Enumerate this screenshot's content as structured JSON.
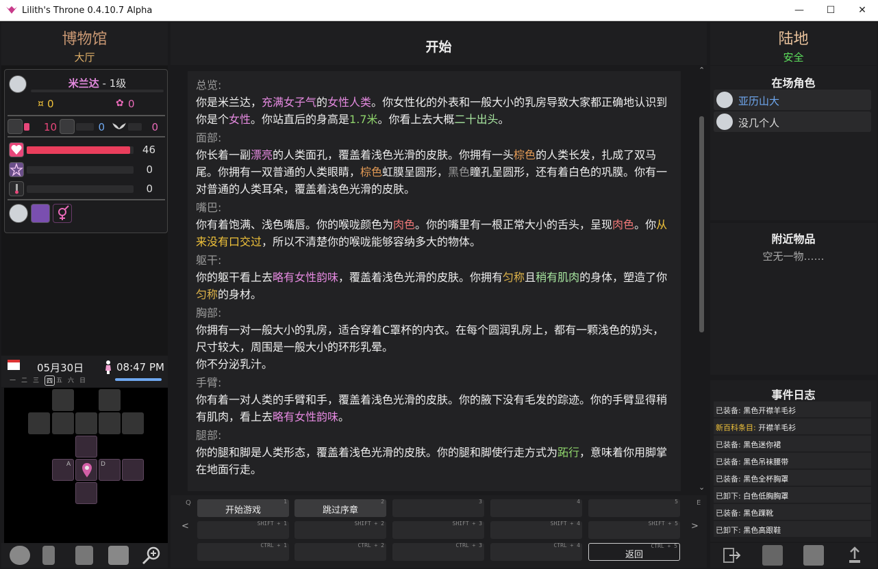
{
  "window": {
    "title": "Lilith's Throne 0.4.10.7 Alpha",
    "min": "—",
    "max": "☐",
    "close": "✕"
  },
  "left": {
    "location_title": "博物馆",
    "location_sub": "大厅",
    "character": {
      "name": "米兰达",
      "level": " - 1级",
      "money": "0",
      "essence": "0",
      "corruption_values": [
        "10",
        "0",
        "0"
      ],
      "health": {
        "value": "46",
        "fraction": 0.97
      },
      "mana": {
        "value": "0"
      },
      "arousal": {
        "value": "0"
      }
    },
    "date": "05月30日",
    "weekdays": [
      "一",
      "二",
      "三",
      "四",
      "五",
      "六",
      "日"
    ],
    "time": "08:47 PM",
    "map_labels": [
      "A",
      "D"
    ]
  },
  "center": {
    "title": "开始",
    "sections": [
      {
        "title": "总览:"
      },
      {
        "title": "面部:"
      },
      {
        "title": "嘴巴:"
      },
      {
        "title": "躯干:"
      },
      {
        "title": "胸部:"
      },
      {
        "title": "手臂:"
      },
      {
        "title": "腿部:"
      }
    ],
    "actions": {
      "row1": [
        {
          "label": "开始游戏",
          "key": "1"
        },
        {
          "label": "跳过序章",
          "key": "2"
        },
        {
          "label": "",
          "key": "3"
        },
        {
          "label": "",
          "key": "4"
        },
        {
          "label": "",
          "key": "5"
        }
      ],
      "row2": [
        "SHIFT + 1",
        "SHIFT + 2",
        "SHIFT + 3",
        "SHIFT + 4",
        "SHIFT + 5"
      ],
      "row3": [
        "CTRL + 1",
        "CTRL + 2",
        "CTRL + 3",
        "CTRL + 4",
        "CTRL + 5"
      ],
      "return_label": "返回",
      "side": {
        "q": "Q",
        "e": "E",
        "prev": "<",
        "next": ">"
      }
    }
  },
  "right": {
    "location_title": "陆地",
    "location_sub": "安全",
    "present_title": "在场角色",
    "present": [
      {
        "name": "亚历山大",
        "color": "#6fa8f0"
      },
      {
        "name": "没几个人",
        "color": "#dddddd"
      }
    ],
    "items_title": "附近物品",
    "items_empty": "空无一物……",
    "log_title": "事件日志",
    "log": [
      {
        "prefix": "已装备:",
        "text": " 黑色开襟羊毛衫",
        "prefix_color": "#dddddd"
      },
      {
        "prefix": "新百科条目:",
        "text": " 开襟羊毛衫",
        "prefix_color": "#f0c23a"
      },
      {
        "prefix": "已装备:",
        "text": " 黑色迷你裙",
        "prefix_color": "#dddddd"
      },
      {
        "prefix": "已装备:",
        "text": " 黑色吊袜腰带",
        "prefix_color": "#dddddd"
      },
      {
        "prefix": "已装备:",
        "text": " 黑色全杯胸罩",
        "prefix_color": "#dddddd"
      },
      {
        "prefix": "已卸下:",
        "text": " 白色低胸胸罩",
        "prefix_color": "#dddddd"
      },
      {
        "prefix": "已装备:",
        "text": " 黑色踝靴",
        "prefix_color": "#dddddd"
      },
      {
        "prefix": "已卸下:",
        "text": " 黑色高跟鞋",
        "prefix_color": "#dddddd"
      }
    ]
  }
}
